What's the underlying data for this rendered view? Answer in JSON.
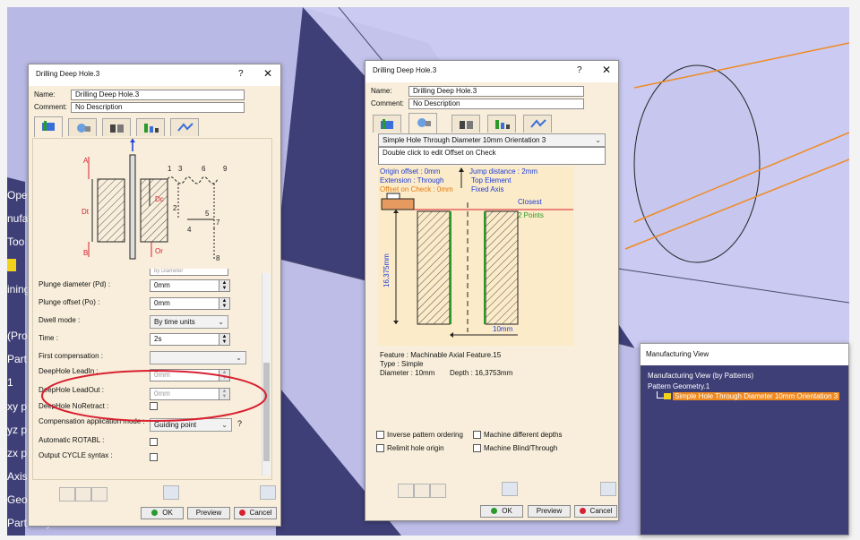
{
  "viewport": {
    "tree_fragments": [
      "Oper",
      "nufa",
      "Too",
      "",
      "ining",
      "(Pro",
      "Part",
      "1",
      "xy p",
      "yz p",
      "zx p",
      "Axis",
      "Geo",
      "PartBody"
    ]
  },
  "dialog_left": {
    "title": "Drilling Deep Hole.3",
    "help": "?",
    "close": "✕",
    "name_label": "Name:",
    "name_value": "Drilling Deep Hole.3",
    "comment_label": "Comment:",
    "comment_value": "No Description",
    "diagram_labels": {
      "A": "A",
      "Dt": "Dt",
      "Dc": "Dc",
      "Or": "Or",
      "B": "B",
      "n1": "1",
      "n2": "2",
      "n3": "3",
      "n4": "4",
      "n5": "5",
      "n6": "6",
      "n7": "7",
      "n8": "8",
      "n9": "9"
    },
    "cropped_value": "by Diameter",
    "params": [
      {
        "label": "Plunge diameter (Pd) :",
        "value": "0mm",
        "kind": "spin"
      },
      {
        "label": "Plunge offset (Po) :",
        "value": "0mm",
        "kind": "spin"
      },
      {
        "label": "Dwell mode :",
        "value": "By time units",
        "kind": "select"
      },
      {
        "label": "Time :",
        "value": "2s",
        "kind": "spin"
      },
      {
        "label": "First compensation :",
        "value": "",
        "kind": "select"
      },
      {
        "label": "DeepHole LeadIn :",
        "value": "0mm",
        "kind": "spin-disabled"
      },
      {
        "label": "DeepHole LeadOut :",
        "value": "0mm",
        "kind": "spin-disabled"
      },
      {
        "label": "DeepHole NoRetract :",
        "value": "",
        "kind": "check"
      },
      {
        "label": "Compensation application mode :",
        "value": "Guiding point",
        "kind": "select-help"
      },
      {
        "label": "Automatic ROTABL :",
        "value": "",
        "kind": "check"
      },
      {
        "label": "Output CYCLE syntax :",
        "value": "",
        "kind": "check"
      }
    ],
    "help_mark": "?",
    "ok": "OK",
    "preview": "Preview",
    "cancel": "Cancel"
  },
  "dialog_right": {
    "title": "Drilling Deep Hole.3",
    "help": "?",
    "close": "✕",
    "name_label": "Name:",
    "name_value": "Drilling Deep Hole.3",
    "comment_label": "Comment:",
    "comment_value": "No Description",
    "pattern_select": "Simple Hole Through Diameter 10mm Orientation 3",
    "hint": "Double click to edit Offset on Check",
    "info": {
      "origin_offset": "Origin offset : 0mm",
      "extension": "Extension  : Through",
      "offset_on_check": "Offset on Check : 0mm",
      "jump_distance": "Jump distance : 2mm",
      "top_element": "Top Element",
      "fixed_axis": "Fixed Axis",
      "closest": "Closest",
      "two_points": "2 Points",
      "depth_dim": "16,375mm",
      "width_dim": "10mm",
      "feature": "Feature : Machinable Axial Feature.15",
      "type": "Type : Simple",
      "diameter": "Diameter : 10mm",
      "depth": "Depth : 16,3753mm"
    },
    "checkboxes": [
      "Inverse pattern ordering",
      "Machine different depths",
      "Relimit hole origin",
      "Machine Blind/Through"
    ],
    "ok": "OK",
    "preview": "Preview",
    "cancel": "Cancel"
  },
  "manufacturing_view": {
    "title": "Manufacturing View",
    "root": "Manufacturing View (by Patterns)",
    "child": "Pattern Geometry.1",
    "leaf": "Simple Hole Through Diameter 10mm Orientation 3"
  },
  "colors": {
    "viewport_bg": "#3f3f78",
    "part_surface": "#c4c4ee",
    "dialog_body": "#f8eedb",
    "highlight_orange": "#f08a20",
    "annotation_red": "#d82030",
    "info_blue": "#1a3cd8",
    "info_orange": "#e07a10"
  }
}
